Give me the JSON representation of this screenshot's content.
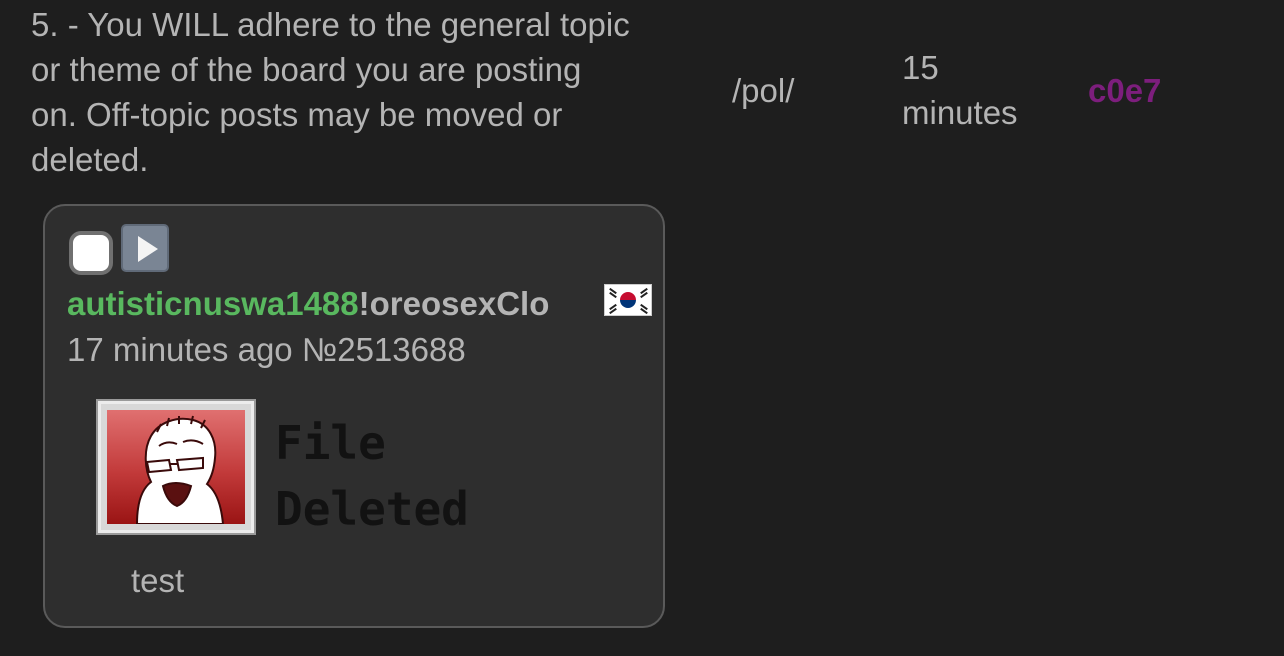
{
  "rule": {
    "text": "5. - You WILL adhere to the general topic or theme of the board you are posting on. Off-topic posts may be moved or deleted."
  },
  "ban_info": {
    "board": "/pol/",
    "duration": "15 minutes",
    "mod_id": "c0e7"
  },
  "post": {
    "name": "autisticnuswa1488",
    "tripcode": "!oreosexClo",
    "flag_icon": "south-korea-flag",
    "meta": "17 minutes ago №2513688",
    "file_status": "File\nDeleted",
    "comment": "test"
  },
  "colors": {
    "background": "#1e1e1e",
    "post_background": "#2e2e2e",
    "name": "#59b85f",
    "mod_id": "#7d1e7d",
    "text": "#b4b4b4"
  }
}
